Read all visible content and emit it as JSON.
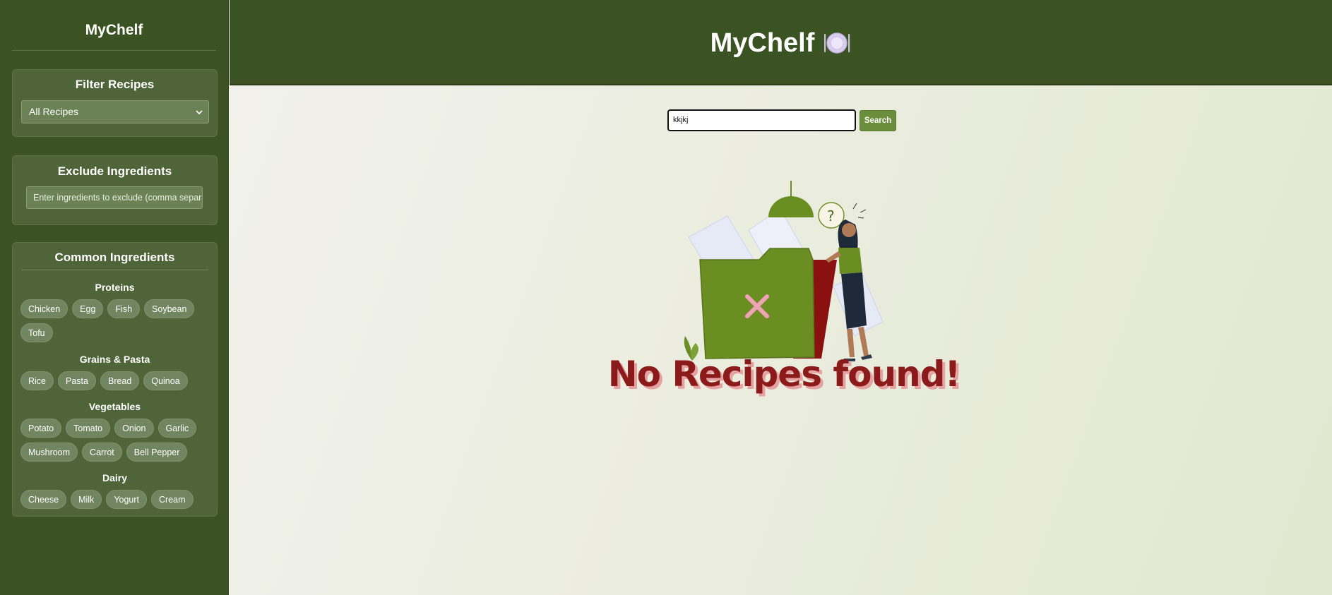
{
  "app": {
    "name": "MyChelf"
  },
  "sidebar": {
    "title": "MyChelf",
    "filter": {
      "heading": "Filter Recipes",
      "selected": "All Recipes"
    },
    "exclude": {
      "heading": "Exclude Ingredients",
      "placeholder": "Enter ingredients to exclude (comma separa"
    },
    "common": {
      "heading": "Common Ingredients",
      "groups": [
        {
          "label": "Proteins",
          "items": [
            "Chicken",
            "Egg",
            "Fish",
            "Soybean",
            "Tofu"
          ]
        },
        {
          "label": "Grains & Pasta",
          "items": [
            "Rice",
            "Pasta",
            "Bread",
            "Quinoa"
          ]
        },
        {
          "label": "Vegetables",
          "items": [
            "Potato",
            "Tomato",
            "Onion",
            "Garlic",
            "Mushroom",
            "Carrot",
            "Bell Pepper"
          ]
        },
        {
          "label": "Dairy",
          "items": [
            "Cheese",
            "Milk",
            "Yogurt",
            "Cream"
          ]
        }
      ]
    }
  },
  "header": {
    "title": "MyChelf",
    "icon": "plate-icon"
  },
  "search": {
    "value": "kkjkj",
    "button": "Search"
  },
  "empty_state": {
    "message": "No Recipes found!",
    "illustration": "empty-folder-illustration"
  },
  "colors": {
    "sidebar_bg": "#3b5323",
    "accent_green": "#6b8e3c",
    "message_red": "#8b1a1a",
    "message_shadow": "#e6a2a2"
  }
}
